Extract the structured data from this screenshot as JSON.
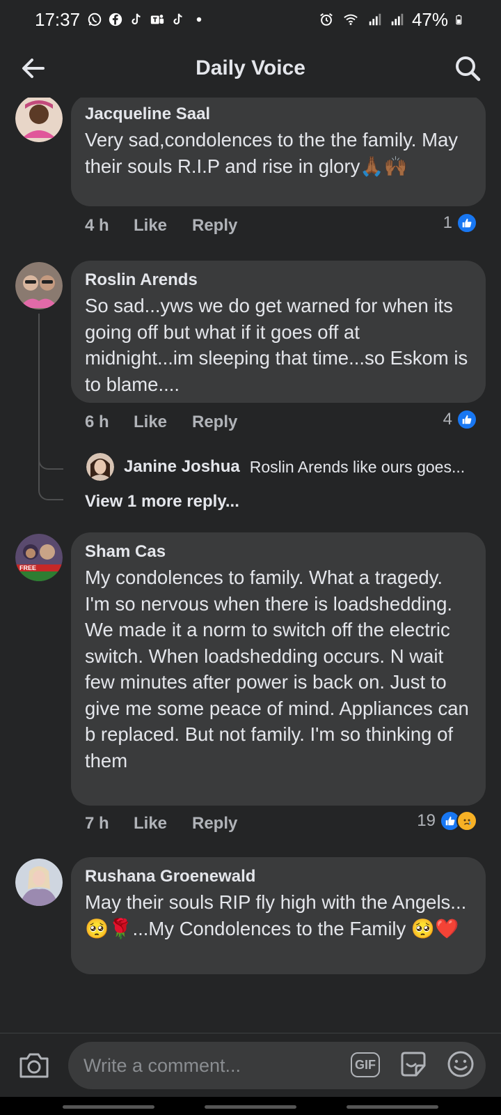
{
  "status_bar": {
    "time": "17:37",
    "battery": "47%",
    "left_icons": [
      "whatsapp-icon",
      "facebook-icon",
      "tiktok-icon",
      "teams-icon",
      "tiktok-icon",
      "dot-icon"
    ],
    "right_icons": [
      "alarm-icon",
      "wifi-icon",
      "signal-icon",
      "signal-icon",
      "battery-icon"
    ]
  },
  "app_bar": {
    "title": "Daily Voice",
    "back_icon": "arrow-left-icon",
    "search_icon": "search-icon"
  },
  "comments": [
    {
      "author": "Jacqueline Saal",
      "text": "Very sad,condolences to the the family. May their souls R.I.P and rise in glory🙏🏾🙌🏾",
      "time": "4 h",
      "like_label": "Like",
      "reply_label": "Reply",
      "reaction_count": "1",
      "reactions": [
        "like"
      ]
    },
    {
      "author": "Roslin Arends",
      "text": "So sad...yws we do get warned for when its going off but what if it goes off at midnight...im sleeping that time...so Eskom is to blame....",
      "time": "6 h",
      "like_label": "Like",
      "reply_label": "Reply",
      "reaction_count": "4",
      "reactions": [
        "like"
      ],
      "reply_preview": {
        "author": "Janine Joshua",
        "text": "Roslin Arends like ours goes..."
      },
      "view_more": "View 1 more reply..."
    },
    {
      "author": "Sham Cas",
      "text": "My condolences to family. What a tragedy. I'm so nervous when there is loadshedding. We made it a norm to switch off the electric switch. When loadshedding occurs. N wait few minutes after power is back on. Just to give me some peace of mind. Appliances can b replaced. But not family. I'm so thinking of them",
      "time": "7 h",
      "like_label": "Like",
      "reply_label": "Reply",
      "reaction_count": "19",
      "reactions": [
        "like",
        "sad"
      ]
    },
    {
      "author": "Rushana Groenewald",
      "text": "May their souls RIP fly high with the Angels...🥺🌹...My Condolences to the Family 🥺❤️"
    }
  ],
  "composer": {
    "placeholder": "Write a comment...",
    "gif_label": "GIF",
    "camera_icon": "camera-icon",
    "sticker_icon": "sticker-icon",
    "emoji_icon": "emoji-icon"
  },
  "colors": {
    "background": "#242526",
    "bubble": "#3a3b3c",
    "text": "#e4e6eb",
    "muted": "#b0b3b8",
    "like_blue": "#1877f2",
    "sad_yellow": "#f7b125"
  }
}
